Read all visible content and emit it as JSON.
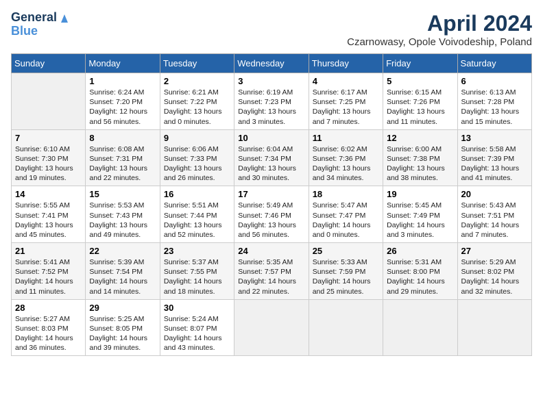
{
  "header": {
    "logo_line1": "General",
    "logo_line2": "Blue",
    "month_year": "April 2024",
    "location": "Czarnowasy, Opole Voivodeship, Poland"
  },
  "weekdays": [
    "Sunday",
    "Monday",
    "Tuesday",
    "Wednesday",
    "Thursday",
    "Friday",
    "Saturday"
  ],
  "weeks": [
    [
      {
        "day": "",
        "empty": true
      },
      {
        "day": "1",
        "sunrise": "6:24 AM",
        "sunset": "7:20 PM",
        "daylight": "12 hours and 56 minutes."
      },
      {
        "day": "2",
        "sunrise": "6:21 AM",
        "sunset": "7:22 PM",
        "daylight": "13 hours and 0 minutes."
      },
      {
        "day": "3",
        "sunrise": "6:19 AM",
        "sunset": "7:23 PM",
        "daylight": "13 hours and 3 minutes."
      },
      {
        "day": "4",
        "sunrise": "6:17 AM",
        "sunset": "7:25 PM",
        "daylight": "13 hours and 7 minutes."
      },
      {
        "day": "5",
        "sunrise": "6:15 AM",
        "sunset": "7:26 PM",
        "daylight": "13 hours and 11 minutes."
      },
      {
        "day": "6",
        "sunrise": "6:13 AM",
        "sunset": "7:28 PM",
        "daylight": "13 hours and 15 minutes."
      }
    ],
    [
      {
        "day": "7",
        "sunrise": "6:10 AM",
        "sunset": "7:30 PM",
        "daylight": "13 hours and 19 minutes."
      },
      {
        "day": "8",
        "sunrise": "6:08 AM",
        "sunset": "7:31 PM",
        "daylight": "13 hours and 22 minutes."
      },
      {
        "day": "9",
        "sunrise": "6:06 AM",
        "sunset": "7:33 PM",
        "daylight": "13 hours and 26 minutes."
      },
      {
        "day": "10",
        "sunrise": "6:04 AM",
        "sunset": "7:34 PM",
        "daylight": "13 hours and 30 minutes."
      },
      {
        "day": "11",
        "sunrise": "6:02 AM",
        "sunset": "7:36 PM",
        "daylight": "13 hours and 34 minutes."
      },
      {
        "day": "12",
        "sunrise": "6:00 AM",
        "sunset": "7:38 PM",
        "daylight": "13 hours and 38 minutes."
      },
      {
        "day": "13",
        "sunrise": "5:58 AM",
        "sunset": "7:39 PM",
        "daylight": "13 hours and 41 minutes."
      }
    ],
    [
      {
        "day": "14",
        "sunrise": "5:55 AM",
        "sunset": "7:41 PM",
        "daylight": "13 hours and 45 minutes."
      },
      {
        "day": "15",
        "sunrise": "5:53 AM",
        "sunset": "7:43 PM",
        "daylight": "13 hours and 49 minutes."
      },
      {
        "day": "16",
        "sunrise": "5:51 AM",
        "sunset": "7:44 PM",
        "daylight": "13 hours and 52 minutes."
      },
      {
        "day": "17",
        "sunrise": "5:49 AM",
        "sunset": "7:46 PM",
        "daylight": "13 hours and 56 minutes."
      },
      {
        "day": "18",
        "sunrise": "5:47 AM",
        "sunset": "7:47 PM",
        "daylight": "14 hours and 0 minutes."
      },
      {
        "day": "19",
        "sunrise": "5:45 AM",
        "sunset": "7:49 PM",
        "daylight": "14 hours and 3 minutes."
      },
      {
        "day": "20",
        "sunrise": "5:43 AM",
        "sunset": "7:51 PM",
        "daylight": "14 hours and 7 minutes."
      }
    ],
    [
      {
        "day": "21",
        "sunrise": "5:41 AM",
        "sunset": "7:52 PM",
        "daylight": "14 hours and 11 minutes."
      },
      {
        "day": "22",
        "sunrise": "5:39 AM",
        "sunset": "7:54 PM",
        "daylight": "14 hours and 14 minutes."
      },
      {
        "day": "23",
        "sunrise": "5:37 AM",
        "sunset": "7:55 PM",
        "daylight": "14 hours and 18 minutes."
      },
      {
        "day": "24",
        "sunrise": "5:35 AM",
        "sunset": "7:57 PM",
        "daylight": "14 hours and 22 minutes."
      },
      {
        "day": "25",
        "sunrise": "5:33 AM",
        "sunset": "7:59 PM",
        "daylight": "14 hours and 25 minutes."
      },
      {
        "day": "26",
        "sunrise": "5:31 AM",
        "sunset": "8:00 PM",
        "daylight": "14 hours and 29 minutes."
      },
      {
        "day": "27",
        "sunrise": "5:29 AM",
        "sunset": "8:02 PM",
        "daylight": "14 hours and 32 minutes."
      }
    ],
    [
      {
        "day": "28",
        "sunrise": "5:27 AM",
        "sunset": "8:03 PM",
        "daylight": "14 hours and 36 minutes."
      },
      {
        "day": "29",
        "sunrise": "5:25 AM",
        "sunset": "8:05 PM",
        "daylight": "14 hours and 39 minutes."
      },
      {
        "day": "30",
        "sunrise": "5:24 AM",
        "sunset": "8:07 PM",
        "daylight": "14 hours and 43 minutes."
      },
      {
        "day": "",
        "empty": true
      },
      {
        "day": "",
        "empty": true
      },
      {
        "day": "",
        "empty": true
      },
      {
        "day": "",
        "empty": true
      }
    ]
  ]
}
